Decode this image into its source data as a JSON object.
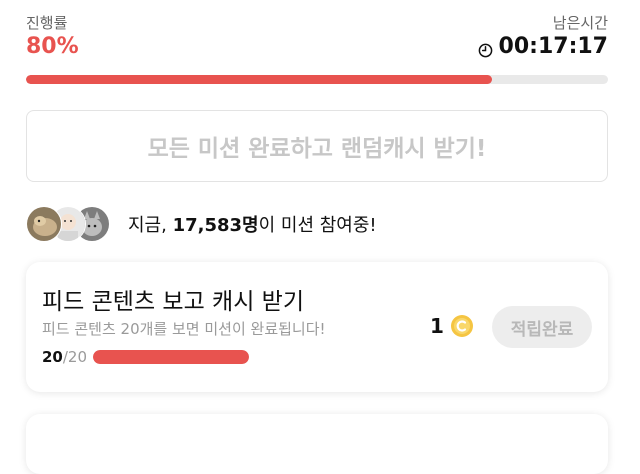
{
  "header": {
    "progress_label": "진행률",
    "progress_value": "80%",
    "time_label": "남은시간",
    "time_value": "00:17:17",
    "clock_icon": "clock-icon"
  },
  "progress": {
    "fraction": 0.8,
    "fill_color": "#e8534f",
    "track_color": "#e9e9e9"
  },
  "reward_button": {
    "label": "모든 미션 완료하고 랜덤캐시 받기!",
    "disabled": true
  },
  "participants": {
    "prefix": "지금, ",
    "count": "17,583명",
    "suffix": "이 미션 참여중!",
    "avatars": [
      "avatar-dog",
      "avatar-baby",
      "avatar-cat"
    ]
  },
  "missions": [
    {
      "title": "피드 콘텐츠 보고 캐시 받기",
      "description": "피드 콘텐츠 20개를 보면 미션이 완료됩니다!",
      "count_done": "20",
      "count_total": "/20",
      "progress_fraction": 1.0,
      "reward": "1",
      "reward_icon": "coin-icon",
      "status_label": "적립완료"
    }
  ],
  "colors": {
    "accent": "#e8534f",
    "coin": "#f5c542",
    "disabled_text": "#c7c7c7"
  }
}
